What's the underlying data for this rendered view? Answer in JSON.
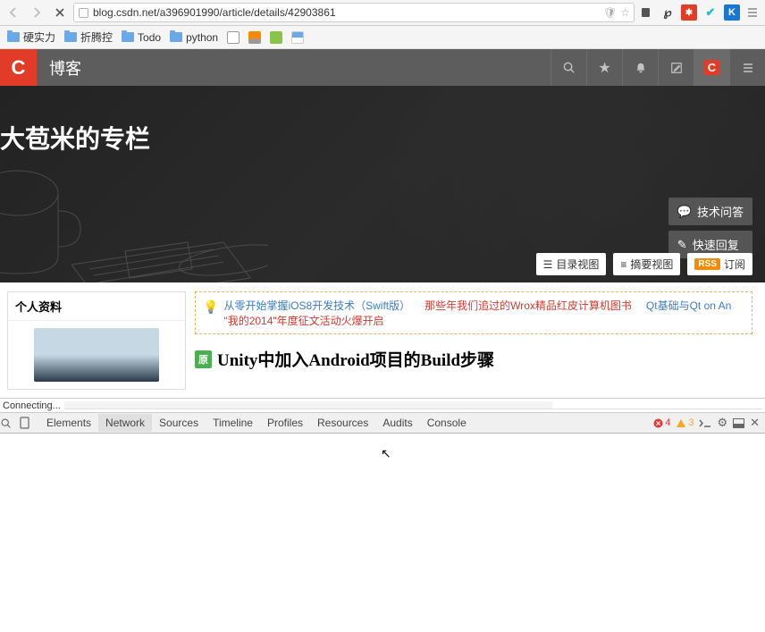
{
  "browser": {
    "url": "blog.csdn.net/a396901990/article/details/42903861",
    "bookmarks": [
      {
        "label": "硬实力",
        "type": "folder"
      },
      {
        "label": "折腾控",
        "type": "folder"
      },
      {
        "label": "Todo",
        "type": "folder"
      },
      {
        "label": "python",
        "type": "folder"
      },
      {
        "label": "",
        "type": "icon",
        "bg": "#fff",
        "fg": "#000"
      },
      {
        "label": "",
        "type": "icon",
        "bg": "#fff",
        "fg": "#f78b00"
      },
      {
        "label": "",
        "type": "icon",
        "bg": "#8bc34a",
        "fg": "#fff"
      },
      {
        "label": "",
        "type": "icon",
        "bg": "#e0e0e0",
        "fg": "#333"
      }
    ],
    "ext_colors": [
      "#777",
      "#777",
      "#333",
      "#000",
      "#e23c29",
      "#1ec0d8",
      "#1976d2"
    ]
  },
  "page": {
    "logo": "C",
    "nav_title": "博客",
    "blog_title": "大苞米的专栏",
    "hero_buttons": [
      {
        "icon": "💬",
        "label": "技术问答"
      },
      {
        "icon": "✎",
        "label": "快速回复"
      }
    ],
    "view_buttons": [
      {
        "icon": "☰",
        "label": "目录视图"
      },
      {
        "icon": "≡",
        "label": "摘要视图"
      }
    ],
    "rss": {
      "badge": "RSS",
      "label": "订阅"
    },
    "sidebar_title": "个人资料",
    "notice": [
      {
        "text": "从零开始掌握iOS8开发技术（Swift版）",
        "cls": "link-blue"
      },
      {
        "text": "那些年我们追过的Wrox精品红皮计算机图书",
        "cls": "link-red"
      },
      {
        "text": "Qt基础与Qt on An",
        "cls": "link-blue"
      },
      {
        "text": "\"我的2014\"年度征文活动火爆开启",
        "cls": "link-red"
      }
    ],
    "orig_badge": "原",
    "article_title": "Unity中加入Android项目的Build步骤"
  },
  "status": "Connecting...",
  "devtools": {
    "tabs": [
      "Elements",
      "Network",
      "Sources",
      "Timeline",
      "Profiles",
      "Resources",
      "Audits",
      "Console"
    ],
    "active": "Network",
    "errors": "4",
    "warnings": "3"
  }
}
